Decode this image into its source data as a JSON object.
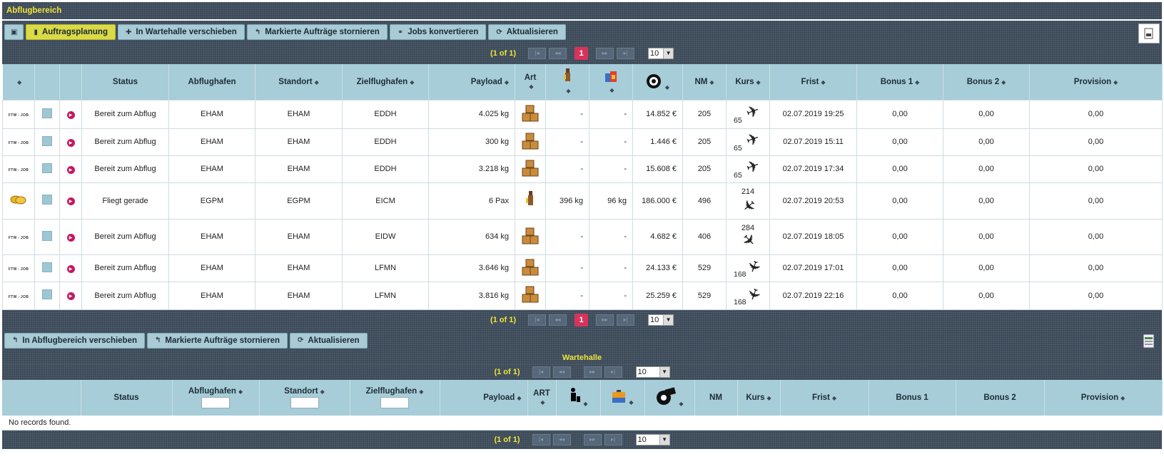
{
  "window": {
    "title": "Abflugbereich"
  },
  "toolbar": {
    "buttons": [
      {
        "label": "Auftragsplanung",
        "icon": "clipboard-icon",
        "active": true
      },
      {
        "label": "In Wartehalle verschieben",
        "icon": "plus-icon"
      },
      {
        "label": "Markierte Aufträge stornieren",
        "icon": "undo-icon"
      },
      {
        "label": "Jobs konvertieren",
        "icon": "link-icon"
      },
      {
        "label": "Aktualisieren",
        "icon": "refresh-icon"
      }
    ]
  },
  "pager": {
    "info": "(1 of 1)",
    "page": "1",
    "rows_per_page": "10"
  },
  "table": {
    "headers": {
      "status": "Status",
      "abflughafen": "Abflughafen",
      "standort": "Standort",
      "zielflughafen": "Zielflughafen",
      "payload": "Payload",
      "art": "Art",
      "nm": "NM",
      "kurs": "Kurs",
      "frist": "Frist",
      "bonus1": "Bonus 1",
      "bonus2": "Bonus 2",
      "provision": "Provision"
    },
    "rows": [
      {
        "type_icon": "ftw-job-logo",
        "type_label": "FTW - JOB",
        "status": "Bereit zum Abflug",
        "abflughafen": "EHAM",
        "standort": "EHAM",
        "zielflughafen": "EDDH",
        "payload": "4.025 kg",
        "art": "cargo",
        "pax_weight": "-",
        "baggage": "-",
        "revenue": "14.852 €",
        "nm": "205",
        "kurs": "65",
        "frist": "02.07.2019 19:25",
        "bonus1": "0,00",
        "bonus2": "0,00",
        "provision": "0,00"
      },
      {
        "type_icon": "ftw-job-logo",
        "type_label": "FTW - JOB",
        "status": "Bereit zum Abflug",
        "abflughafen": "EHAM",
        "standort": "EHAM",
        "zielflughafen": "EDDH",
        "payload": "300 kg",
        "art": "cargo",
        "pax_weight": "-",
        "baggage": "-",
        "revenue": "1.446 €",
        "nm": "205",
        "kurs": "65",
        "frist": "02.07.2019 15:11",
        "bonus1": "0,00",
        "bonus2": "0,00",
        "provision": "0,00"
      },
      {
        "type_icon": "ftw-job-logo",
        "type_label": "FTW - JOB",
        "status": "Bereit zum Abflug",
        "abflughafen": "EHAM",
        "standort": "EHAM",
        "zielflughafen": "EDDH",
        "payload": "3.218 kg",
        "art": "cargo",
        "pax_weight": "-",
        "baggage": "-",
        "revenue": "15.608 €",
        "nm": "205",
        "kurs": "65",
        "frist": "02.07.2019 17:34",
        "bonus1": "0,00",
        "bonus2": "0,00",
        "provision": "0,00"
      },
      {
        "type_icon": "coins-icon",
        "type_label": "",
        "status": "Fliegt gerade",
        "abflughafen": "EGPM",
        "standort": "EGPM",
        "zielflughafen": "EICM",
        "payload": "6 Pax",
        "art": "passenger",
        "pax_weight": "396 kg",
        "baggage": "96 kg",
        "revenue": "186.000 €",
        "nm": "496",
        "kurs": "214",
        "frist": "02.07.2019 20:53",
        "bonus1": "0,00",
        "bonus2": "0,00",
        "provision": "0,00"
      },
      {
        "type_icon": "ftw-job-logo",
        "type_label": "FTW - JOB",
        "status": "Bereit zum Abflug",
        "abflughafen": "EHAM",
        "standort": "EHAM",
        "zielflughafen": "EIDW",
        "payload": "634 kg",
        "art": "cargo",
        "pax_weight": "-",
        "baggage": "-",
        "revenue": "4.682 €",
        "nm": "406",
        "kurs": "284",
        "frist": "02.07.2019 18:05",
        "bonus1": "0,00",
        "bonus2": "0,00",
        "provision": "0,00"
      },
      {
        "type_icon": "ftw-job-logo",
        "type_label": "FTW - JOB",
        "status": "Bereit zum Abflug",
        "abflughafen": "EHAM",
        "standort": "EHAM",
        "zielflughafen": "LFMN",
        "payload": "3.646 kg",
        "art": "cargo",
        "pax_weight": "-",
        "baggage": "-",
        "revenue": "24.133 €",
        "nm": "529",
        "kurs": "168",
        "frist": "02.07.2019 17:01",
        "bonus1": "0,00",
        "bonus2": "0,00",
        "provision": "0,00"
      },
      {
        "type_icon": "ftw-job-logo",
        "type_label": "FTW - JOB",
        "status": "Bereit zum Abflug",
        "abflughafen": "EHAM",
        "standort": "EHAM",
        "zielflughafen": "LFMN",
        "payload": "3.816 kg",
        "art": "cargo",
        "pax_weight": "-",
        "baggage": "-",
        "revenue": "25.259 €",
        "nm": "529",
        "kurs": "168",
        "frist": "02.07.2019 22:16",
        "bonus1": "0,00",
        "bonus2": "0,00",
        "provision": "0,00"
      }
    ]
  },
  "toolbar2": {
    "buttons": [
      {
        "label": "In Abflugbereich verschieben",
        "icon": "undo-icon"
      },
      {
        "label": "Markierte Aufträge stornieren",
        "icon": "undo-icon"
      },
      {
        "label": "Aktualisieren",
        "icon": "refresh-icon"
      }
    ]
  },
  "wartehalle": {
    "title": "Wartehalle",
    "pager": {
      "info": "(1 of 1)",
      "rows_per_page": "10"
    },
    "headers": {
      "status": "Status",
      "abflughafen": "Abflughafen",
      "standort": "Standort",
      "zielflughafen": "Zielflughafen",
      "payload": "Payload",
      "art": "ART",
      "nm": "NM",
      "kurs": "Kurs",
      "frist": "Frist",
      "bonus1": "Bonus 1",
      "bonus2": "Bonus 2",
      "provision": "Provision"
    },
    "empty_message": "No records found."
  }
}
